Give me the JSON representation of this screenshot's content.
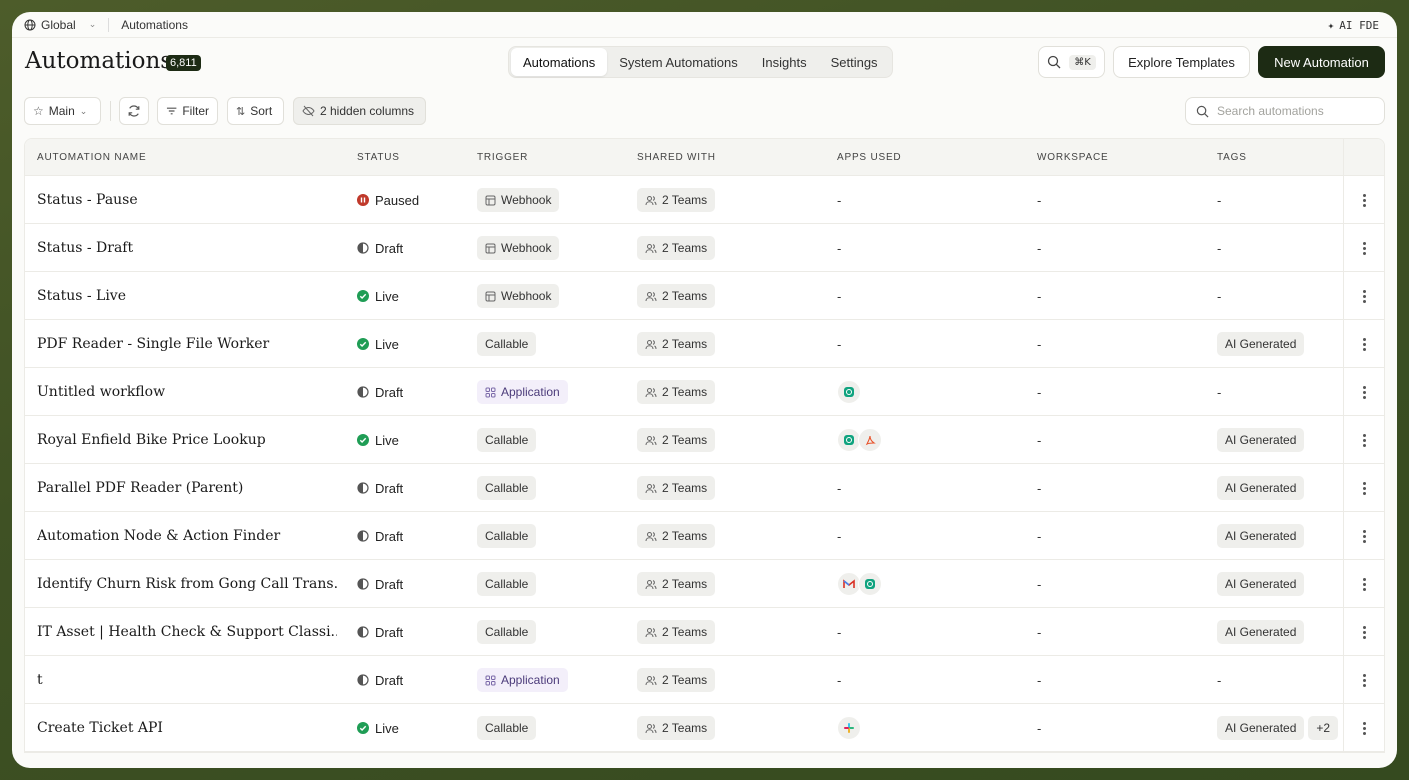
{
  "topbar": {
    "workspace": "Global",
    "breadcrumb": "Automations",
    "ai_label": "AI FDE"
  },
  "header": {
    "title": "Automations",
    "count": "6,811",
    "tabs": [
      {
        "label": "Automations",
        "active": true
      },
      {
        "label": "System Automations",
        "active": false
      },
      {
        "label": "Insights",
        "active": false
      },
      {
        "label": "Settings",
        "active": false
      }
    ],
    "search_shortcut": "⌘K",
    "explore_label": "Explore Templates",
    "new_label": "New Automation"
  },
  "toolbar": {
    "view_label": "Main",
    "filter_label": "Filter",
    "sort_label": "Sort",
    "hidden_columns_label": "2 hidden columns",
    "search_placeholder": "Search automations"
  },
  "table": {
    "columns": [
      "AUTOMATION NAME",
      "STATUS",
      "TRIGGER",
      "SHARED WITH",
      "APPS USED",
      "WORKSPACE",
      "TAGS"
    ],
    "rows": [
      {
        "name": "Status - Pause",
        "status": "Paused",
        "trigger": "Webhook",
        "shared": "2 Teams",
        "apps": "-",
        "workspace": "-",
        "tags": "-"
      },
      {
        "name": "Status - Draft",
        "status": "Draft",
        "trigger": "Webhook",
        "shared": "2 Teams",
        "apps": "-",
        "workspace": "-",
        "tags": "-"
      },
      {
        "name": "Status - Live",
        "status": "Live",
        "trigger": "Webhook",
        "shared": "2 Teams",
        "apps": "-",
        "workspace": "-",
        "tags": "-"
      },
      {
        "name": "PDF Reader - Single File Worker",
        "status": "Live",
        "trigger": "Callable",
        "shared": "2 Teams",
        "apps": "-",
        "workspace": "-",
        "tags": "AI Generated"
      },
      {
        "name": "Untitled workflow",
        "status": "Draft",
        "trigger": "Application",
        "shared": "2 Teams",
        "apps": "",
        "workspace": "-",
        "tags": "-"
      },
      {
        "name": "Royal Enfield Bike Price Lookup",
        "status": "Live",
        "trigger": "Callable",
        "shared": "2 Teams",
        "apps": "",
        "workspace": "-",
        "tags": "AI Generated"
      },
      {
        "name": "Parallel PDF Reader (Parent)",
        "status": "Draft",
        "trigger": "Callable",
        "shared": "2 Teams",
        "apps": "-",
        "workspace": "-",
        "tags": "AI Generated"
      },
      {
        "name": "Automation Node & Action Finder",
        "status": "Draft",
        "trigger": "Callable",
        "shared": "2 Teams",
        "apps": "-",
        "workspace": "-",
        "tags": "AI Generated"
      },
      {
        "name": "Identify Churn Risk from Gong Call Trans...",
        "status": "Draft",
        "trigger": "Callable",
        "shared": "2 Teams",
        "apps": "",
        "workspace": "-",
        "tags": "AI Generated"
      },
      {
        "name": "IT Asset | Health Check & Support Classi...",
        "status": "Draft",
        "trigger": "Callable",
        "shared": "2 Teams",
        "apps": "-",
        "workspace": "-",
        "tags": "AI Generated"
      },
      {
        "name": "t",
        "status": "Draft",
        "trigger": "Application",
        "shared": "2 Teams",
        "apps": "-",
        "workspace": "-",
        "tags": "-"
      },
      {
        "name": "Create Ticket API",
        "status": "Live",
        "trigger": "Callable",
        "shared": "2 Teams",
        "apps": "",
        "workspace": "-",
        "tags": "AI Generated",
        "extra_tags": "+2"
      }
    ]
  },
  "colors": {
    "brand_dark": "#1d2b14",
    "live": "#1f9d55",
    "paused": "#c0392b",
    "draft": "#555555"
  }
}
